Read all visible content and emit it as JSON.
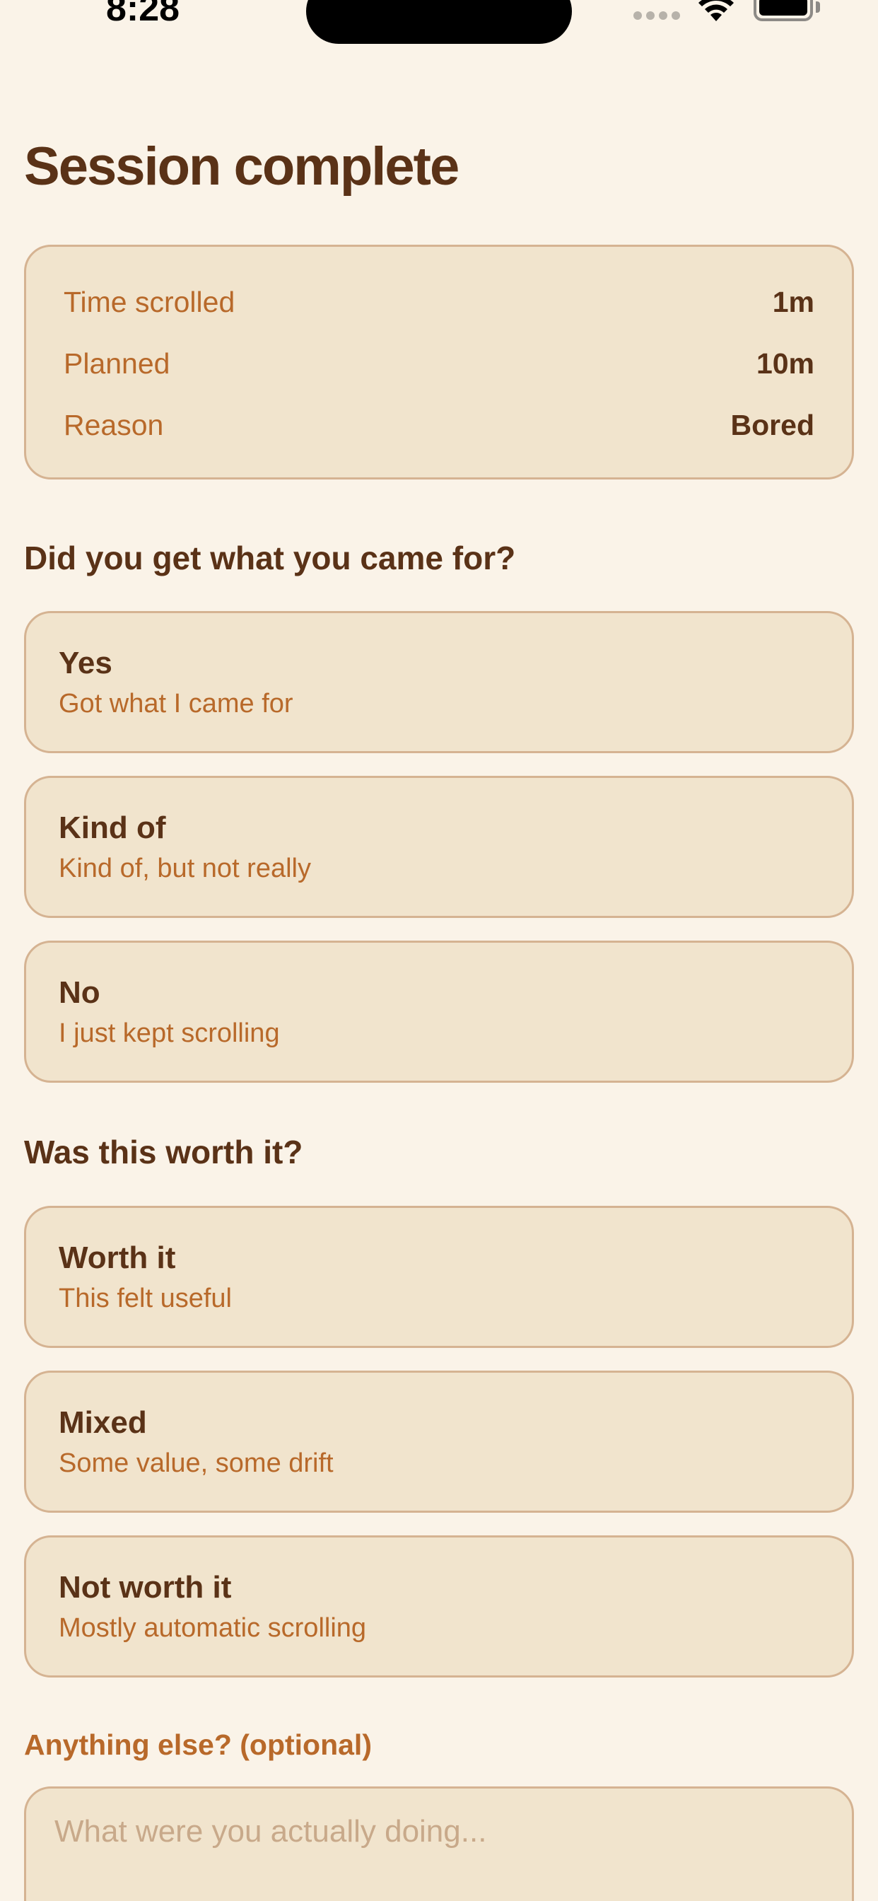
{
  "status_bar": {
    "time": "8:28"
  },
  "page": {
    "title": "Session complete"
  },
  "summary": {
    "rows": [
      {
        "label": "Time scrolled",
        "value": "1m"
      },
      {
        "label": "Planned",
        "value": "10m"
      },
      {
        "label": "Reason",
        "value": "Bored"
      }
    ]
  },
  "question1": {
    "heading": "Did you get what you came for?",
    "options": [
      {
        "title": "Yes",
        "subtitle": "Got what I came for"
      },
      {
        "title": "Kind of",
        "subtitle": "Kind of, but not really"
      },
      {
        "title": "No",
        "subtitle": "I just kept scrolling"
      }
    ]
  },
  "question2": {
    "heading": "Was this worth it?",
    "options": [
      {
        "title": "Worth it",
        "subtitle": "This felt useful"
      },
      {
        "title": "Mixed",
        "subtitle": "Some value, some drift"
      },
      {
        "title": "Not worth it",
        "subtitle": "Mostly automatic scrolling"
      }
    ]
  },
  "notes": {
    "label": "Anything else? (optional)",
    "placeholder": "What were you actually doing...",
    "value": ""
  },
  "colors": {
    "background": "#faf3e8",
    "card": "#f1e4cd",
    "border": "#d5b392",
    "text_primary": "#5a3217",
    "text_accent": "#b8692a"
  },
  "icons": {
    "signal": "cellular-signal-icon",
    "wifi": "wifi-icon",
    "battery": "battery-icon"
  }
}
